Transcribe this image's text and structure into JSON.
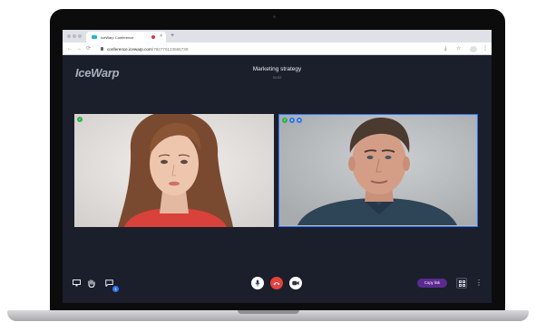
{
  "browser": {
    "tab_title": "IceWarp Conference",
    "tab_close": "×",
    "new_tab": "+",
    "url_host": "conference.icewarp.com",
    "url_path": "/782770123665739",
    "nav": {
      "back": "←",
      "forward": "→",
      "reload": "⟳"
    },
    "icons": {
      "download": "⤓",
      "bookmark": "☆",
      "menu": "⋮"
    }
  },
  "conference": {
    "logo": "IceWarp",
    "meeting_title": "Marketing strategy",
    "elapsed_time": "34:52",
    "participants": [
      {
        "status_badges": [
          "green"
        ]
      },
      {
        "status_badges": [
          "green",
          "blue",
          "blue"
        ],
        "active_speaker": true
      }
    ]
  },
  "controls": {
    "chat_count": "1",
    "copy_link_label": "Copy link",
    "more": "⋮"
  },
  "colors": {
    "accent": "#2f73ff",
    "hangup": "#e8413b",
    "copy_button": "#5b2a91",
    "background": "#1a1f2b"
  }
}
